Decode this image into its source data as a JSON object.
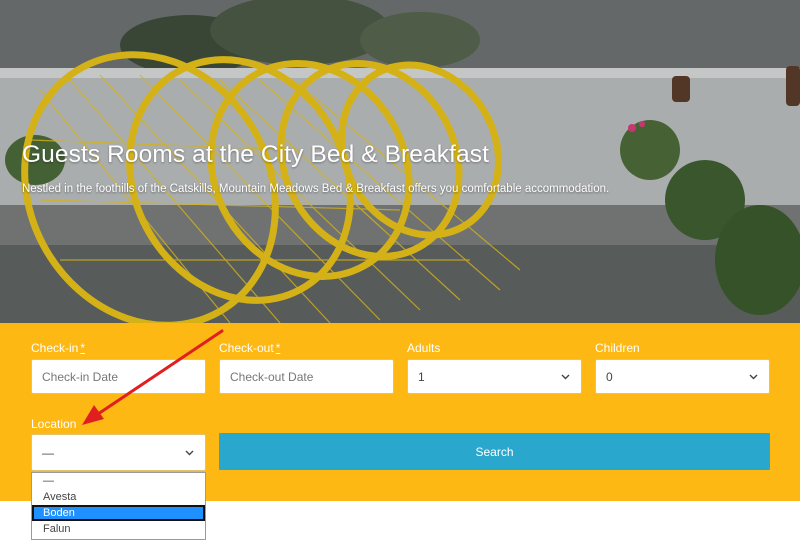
{
  "hero": {
    "title": "Guests Rooms at the City Bed & Breakfast",
    "subtitle": "Nestled in the foothills of the Catskills, Mountain Meadows Bed & Breakfast offers you comfortable accommodation."
  },
  "form": {
    "checkin": {
      "label": "Check-in",
      "required_mark": "*",
      "placeholder": "Check-in Date"
    },
    "checkout": {
      "label": "Check-out",
      "required_mark": "*",
      "placeholder": "Check-out Date"
    },
    "adults": {
      "label": "Adults",
      "value": "1"
    },
    "children": {
      "label": "Children",
      "value": "0"
    },
    "location": {
      "label": "Location",
      "value": "—",
      "options": [
        "—",
        "Avesta",
        "Boden",
        "Falun"
      ],
      "highlighted": "Boden"
    },
    "search_label": "Search"
  },
  "colors": {
    "panel": "#fdb813",
    "button": "#2aa7cc",
    "annotation_arrow": "#e02020",
    "highlight": "#1e90ff"
  },
  "icons": {
    "select_caret": "chevron-down-icon",
    "annotation": "red-arrow-icon"
  }
}
